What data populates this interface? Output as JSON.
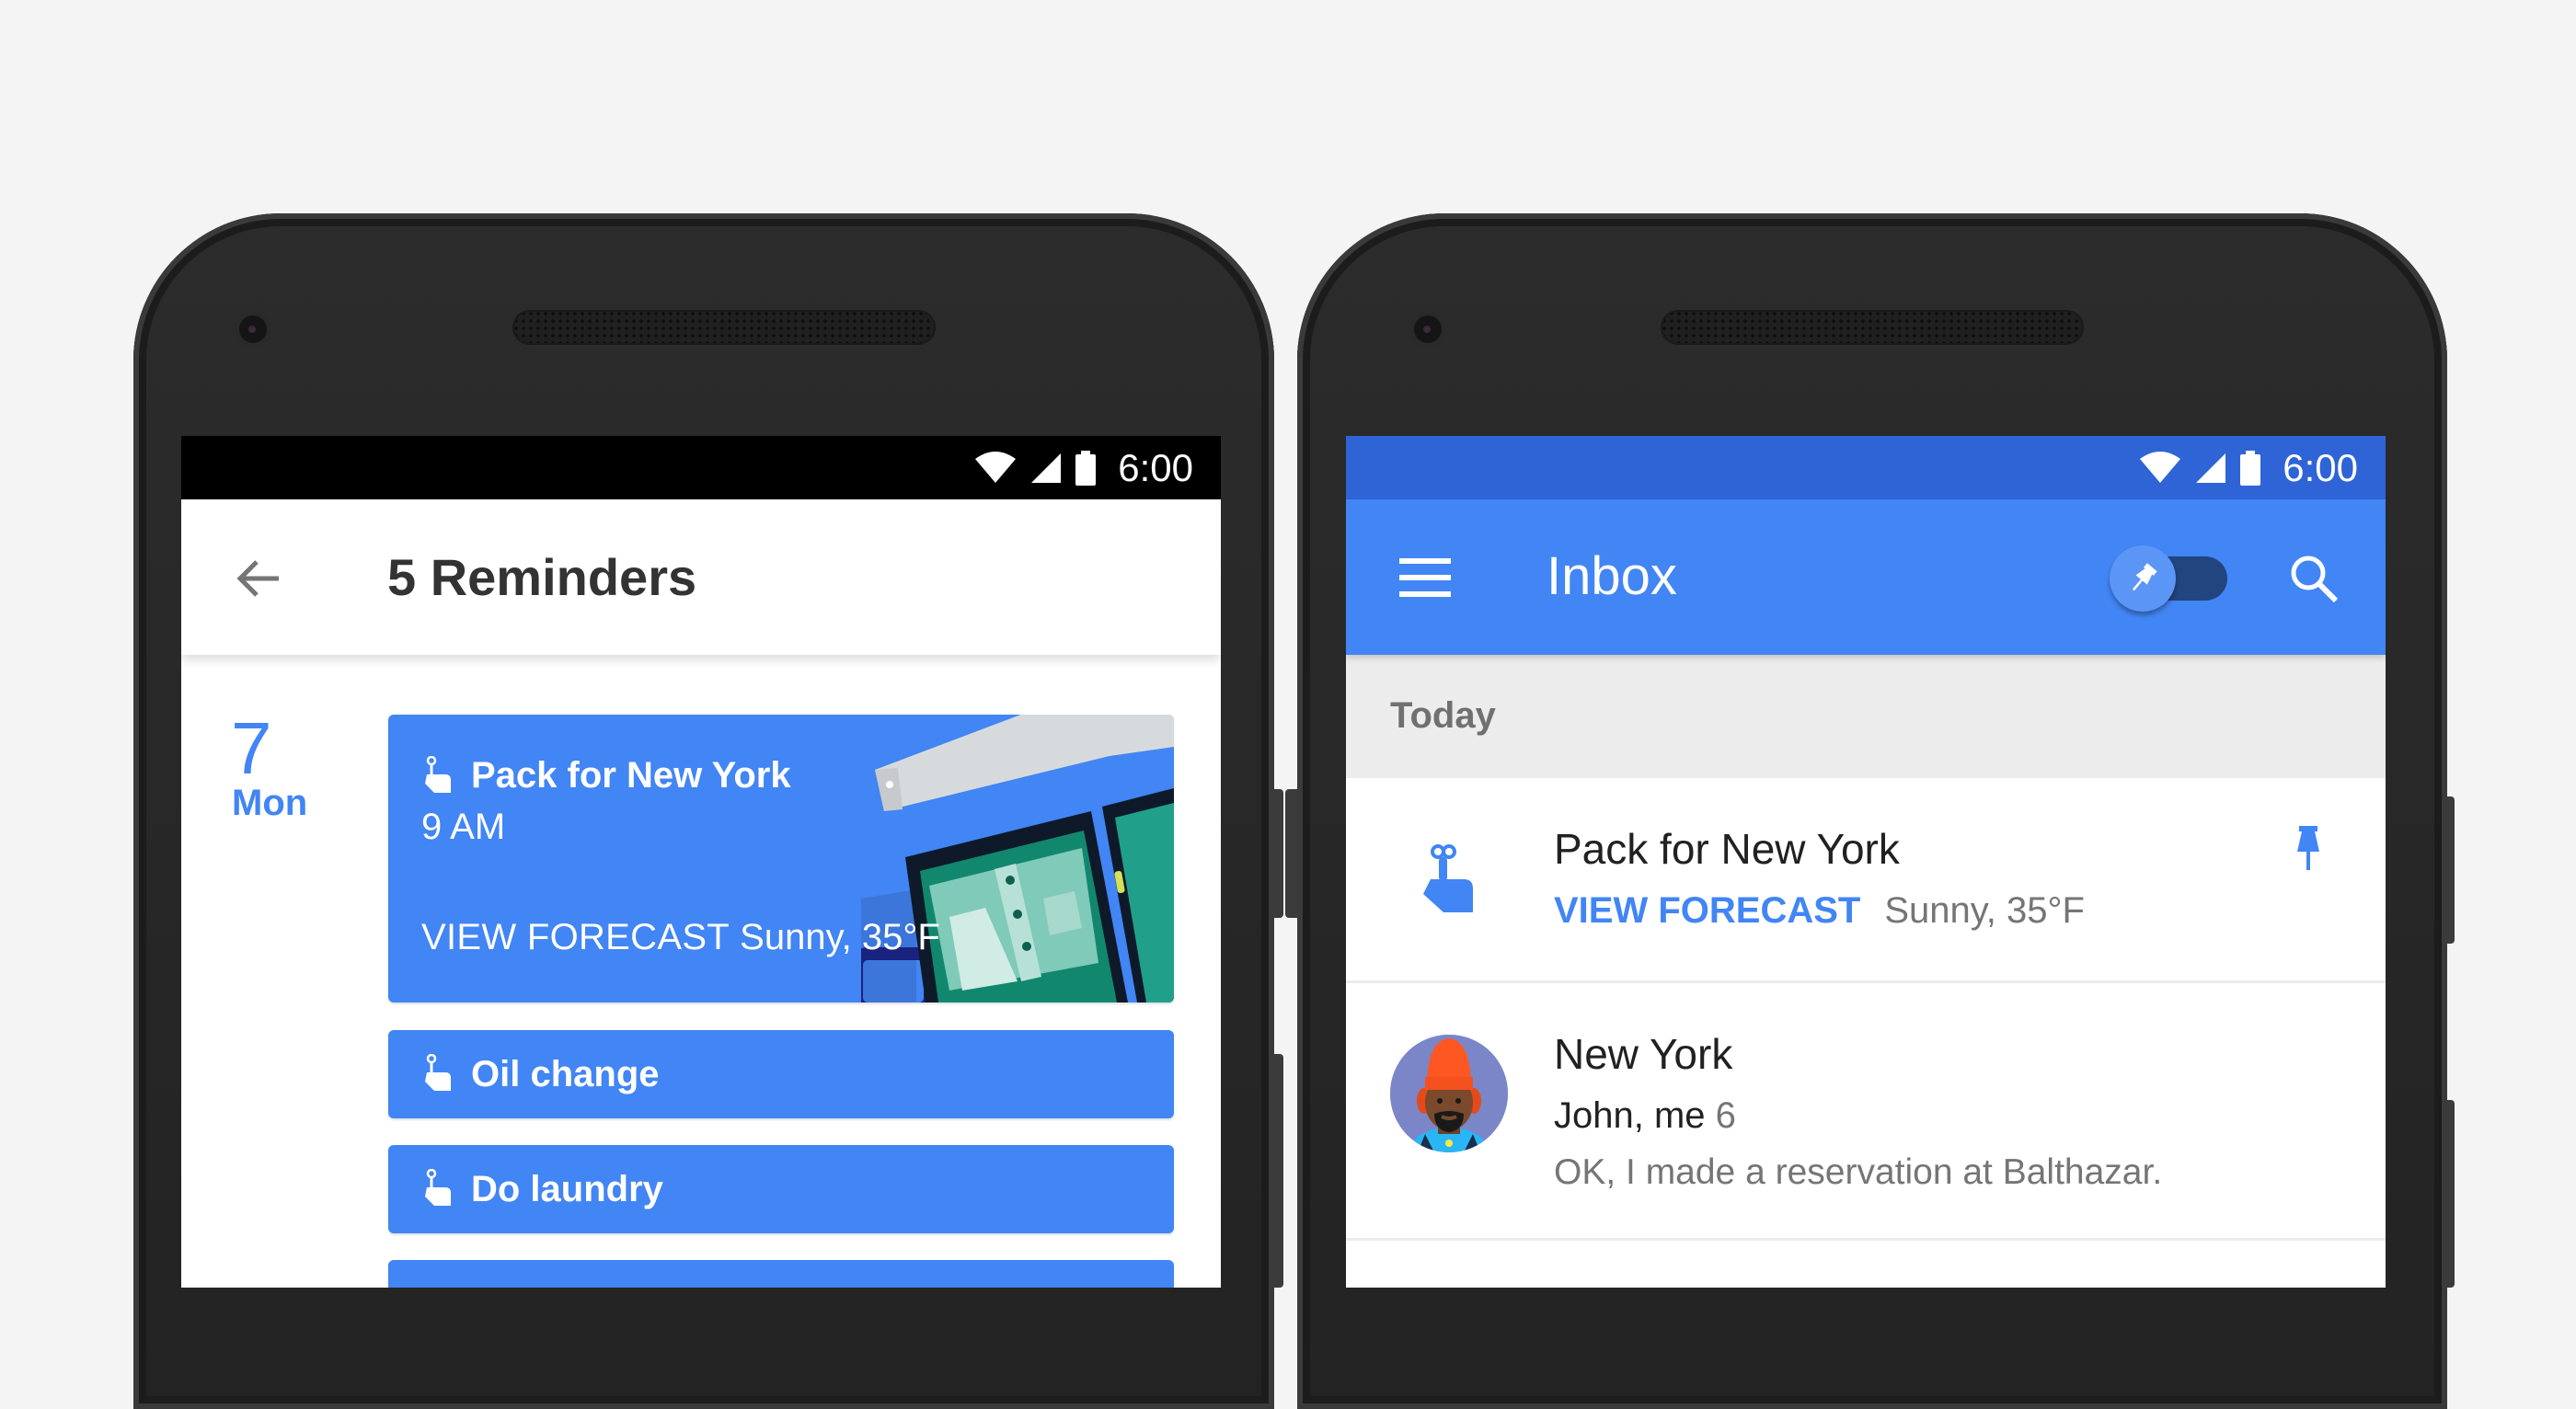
{
  "status_bar": {
    "time": "6:00",
    "icons": [
      "wifi-icon",
      "signal-icon",
      "battery-icon"
    ]
  },
  "reminders_screen": {
    "title": "5 Reminders",
    "back_icon": "arrow-back-icon",
    "date": {
      "day_number": "7",
      "weekday": "Mon"
    },
    "cards": [
      {
        "label": "Pack for New York",
        "time": "9 AM",
        "action": "VIEW FORECAST",
        "detail": "Sunny, 35°F",
        "icon": "reminder-finger-icon",
        "has_illustration": true
      },
      {
        "label": "Oil change",
        "icon": "reminder-finger-icon"
      },
      {
        "label": "Do laundry",
        "icon": "reminder-finger-icon"
      },
      {
        "label": "",
        "icon": ""
      }
    ]
  },
  "inbox_screen": {
    "title": "Inbox",
    "menu_icon": "hamburger-menu-icon",
    "pin_toggle": {
      "icon": "pin-icon",
      "state": "off"
    },
    "search_icon": "search-icon",
    "section_header": "Today",
    "items": [
      {
        "type": "reminder",
        "title": "Pack for New York",
        "action": "VIEW FORECAST",
        "detail": "Sunny, 35°F",
        "pinned": true
      },
      {
        "type": "thread",
        "title": "New York",
        "participants": "John, me",
        "count": "6",
        "snippet": "OK, I made a reservation at Balthazar."
      }
    ]
  },
  "colors": {
    "background": "#f4f4f4",
    "accent_blue": "#4285f4",
    "inbox_status_bar": "#2f64d7",
    "section_band": "#ececec",
    "phone_body": "#262626"
  }
}
